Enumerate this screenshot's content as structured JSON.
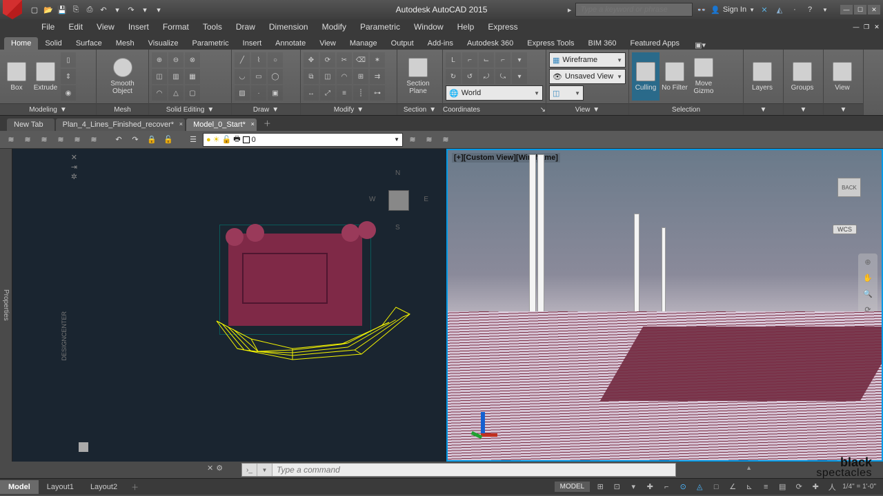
{
  "title": "Autodesk AutoCAD 2015",
  "search_placeholder": "Type a keyword or phrase",
  "signin": "Sign In",
  "menu": [
    "File",
    "Edit",
    "View",
    "Insert",
    "Format",
    "Tools",
    "Draw",
    "Dimension",
    "Modify",
    "Parametric",
    "Window",
    "Help",
    "Express"
  ],
  "ribbonTabs": [
    "Home",
    "Solid",
    "Surface",
    "Mesh",
    "Visualize",
    "Parametric",
    "Insert",
    "Annotate",
    "View",
    "Manage",
    "Output",
    "Add-ins",
    "Autodesk 360",
    "Express Tools",
    "BIM 360",
    "Featured Apps"
  ],
  "activeRibbonTab": 0,
  "panels": {
    "modeling": {
      "label": "Modeling",
      "btns": {
        "box": "Box",
        "extrude": "Extrude",
        "smooth": "Smooth\nObject"
      }
    },
    "mesh": {
      "label": "Mesh"
    },
    "solidEditing": {
      "label": "Solid Editing"
    },
    "draw": {
      "label": "Draw"
    },
    "modify": {
      "label": "Modify"
    },
    "section": {
      "label": "Section",
      "btn": "Section\nPlane"
    },
    "coordinates": {
      "label": "Coordinates",
      "world": "World"
    },
    "view": {
      "label": "View",
      "wireframe": "Wireframe",
      "unsaved": "Unsaved View"
    },
    "selection": {
      "label": "Selection",
      "culling": "Culling",
      "nofilter": "No Filter",
      "gizmo": "Move\nGizmo"
    },
    "layers": {
      "label": "Layers"
    },
    "groups": {
      "label": "Groups"
    },
    "view2": {
      "label": "View"
    }
  },
  "fileTabs": [
    {
      "label": "New Tab",
      "active": false,
      "closable": false
    },
    {
      "label": "Plan_4_Lines_Finished_recover*",
      "active": false,
      "closable": true
    },
    {
      "label": "Model_0_Start*",
      "active": true,
      "closable": true
    }
  ],
  "layerCurrent": "0",
  "viewportLabel": "[+][Custom View][Wireframe]",
  "compass": {
    "n": "N",
    "s": "S",
    "e": "E",
    "w": "W"
  },
  "backLabel": "BACK",
  "wcsLabel": "WCS",
  "propertiesLabel": "Properties",
  "designCenter": "DESIGNCENTER",
  "commandPlaceholder": "Type a command",
  "bottomTabs": [
    "Model",
    "Layout1",
    "Layout2"
  ],
  "activeBottomTab": 0,
  "modelBadge": "MODEL",
  "scale": "1/4\" = 1'-0\"",
  "watermark": {
    "b": "black",
    "s": "spectacles"
  }
}
